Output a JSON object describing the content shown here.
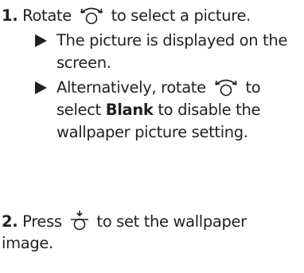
{
  "steps": [
    {
      "number": "1.",
      "text_before_icon": " Rotate ",
      "icon": "rotate-dial-icon",
      "text_after_icon": " to select a picture.",
      "bullets": [
        {
          "line1": "The picture is displayed on the",
          "line2": "screen."
        },
        {
          "line1_before_icon": "Alternatively, rotate ",
          "icon": "rotate-dial-icon",
          "line1_after_icon": " to",
          "line2_before_bold": "select ",
          "line2_bold": "Blank",
          "line2_after_bold": " to disable the",
          "line3": "wallpaper picture setting."
        }
      ]
    },
    {
      "number": "2.",
      "text_before_icon": " Press ",
      "icon": "press-dial-icon",
      "text_after_icon": " to set the wallpaper",
      "line2": "image."
    }
  ]
}
